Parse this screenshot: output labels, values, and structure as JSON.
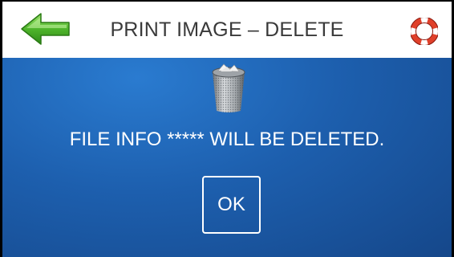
{
  "header": {
    "title": "PRINT IMAGE – DELETE",
    "back_icon": "back-arrow-icon",
    "help_icon": "lifebuoy-help-icon"
  },
  "dialog": {
    "icon": "trash-can-icon",
    "message": "FILE INFO ***** WILL BE DELETED.",
    "ok_label": "OK"
  },
  "colors": {
    "header_bg": "#ffffff",
    "title_text": "#3a3a3a",
    "content_bg": "#1d5fae",
    "back_arrow": "#4caf2a",
    "help_icon": "#e0402a"
  }
}
